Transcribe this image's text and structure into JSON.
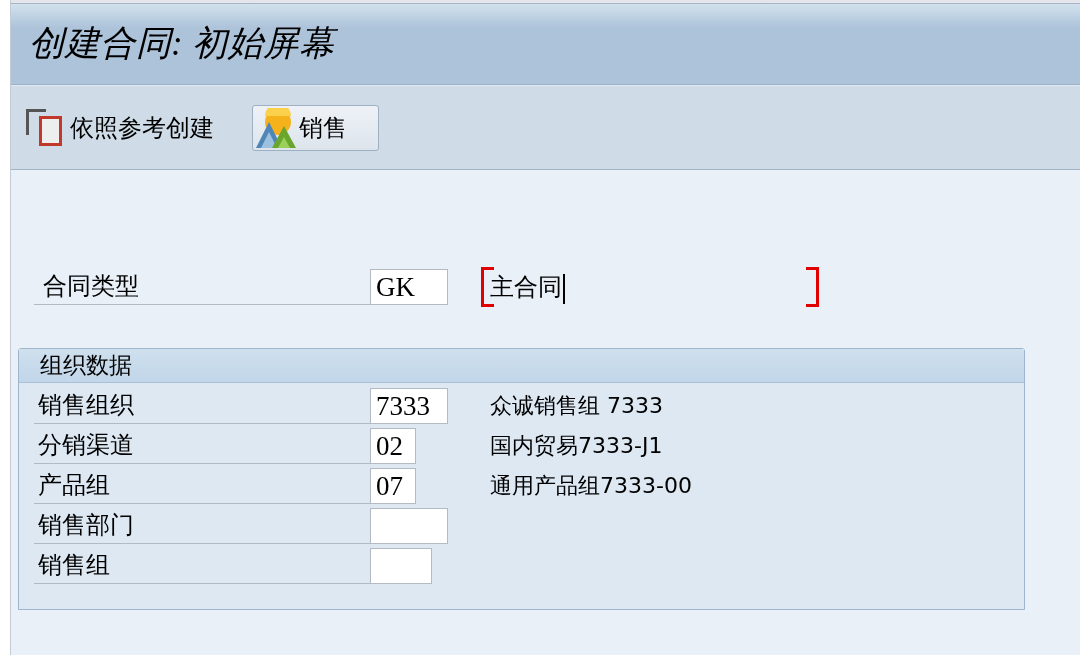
{
  "window": {
    "title": "创建合同: 初始屏幕"
  },
  "toolbar": {
    "buttons": [
      {
        "kind": "plain",
        "label": "依照参考创建"
      },
      {
        "kind": "raised",
        "label": "销售"
      }
    ]
  },
  "contract_type": {
    "label": "合同类型",
    "value": "GK",
    "description": "主合同",
    "focused": true
  },
  "org_data": {
    "title": "组织数据",
    "fields": [
      {
        "label": "销售组织",
        "value": "7333",
        "description": "众诚销售组 7333"
      },
      {
        "label": "分销渠道",
        "value": "02",
        "description": "国内贸易7333-J1"
      },
      {
        "label": "产品组",
        "value": "07",
        "description": "通用产品组7333-00"
      },
      {
        "label": "销售部门"
      },
      {
        "label": "销售组"
      }
    ]
  }
}
